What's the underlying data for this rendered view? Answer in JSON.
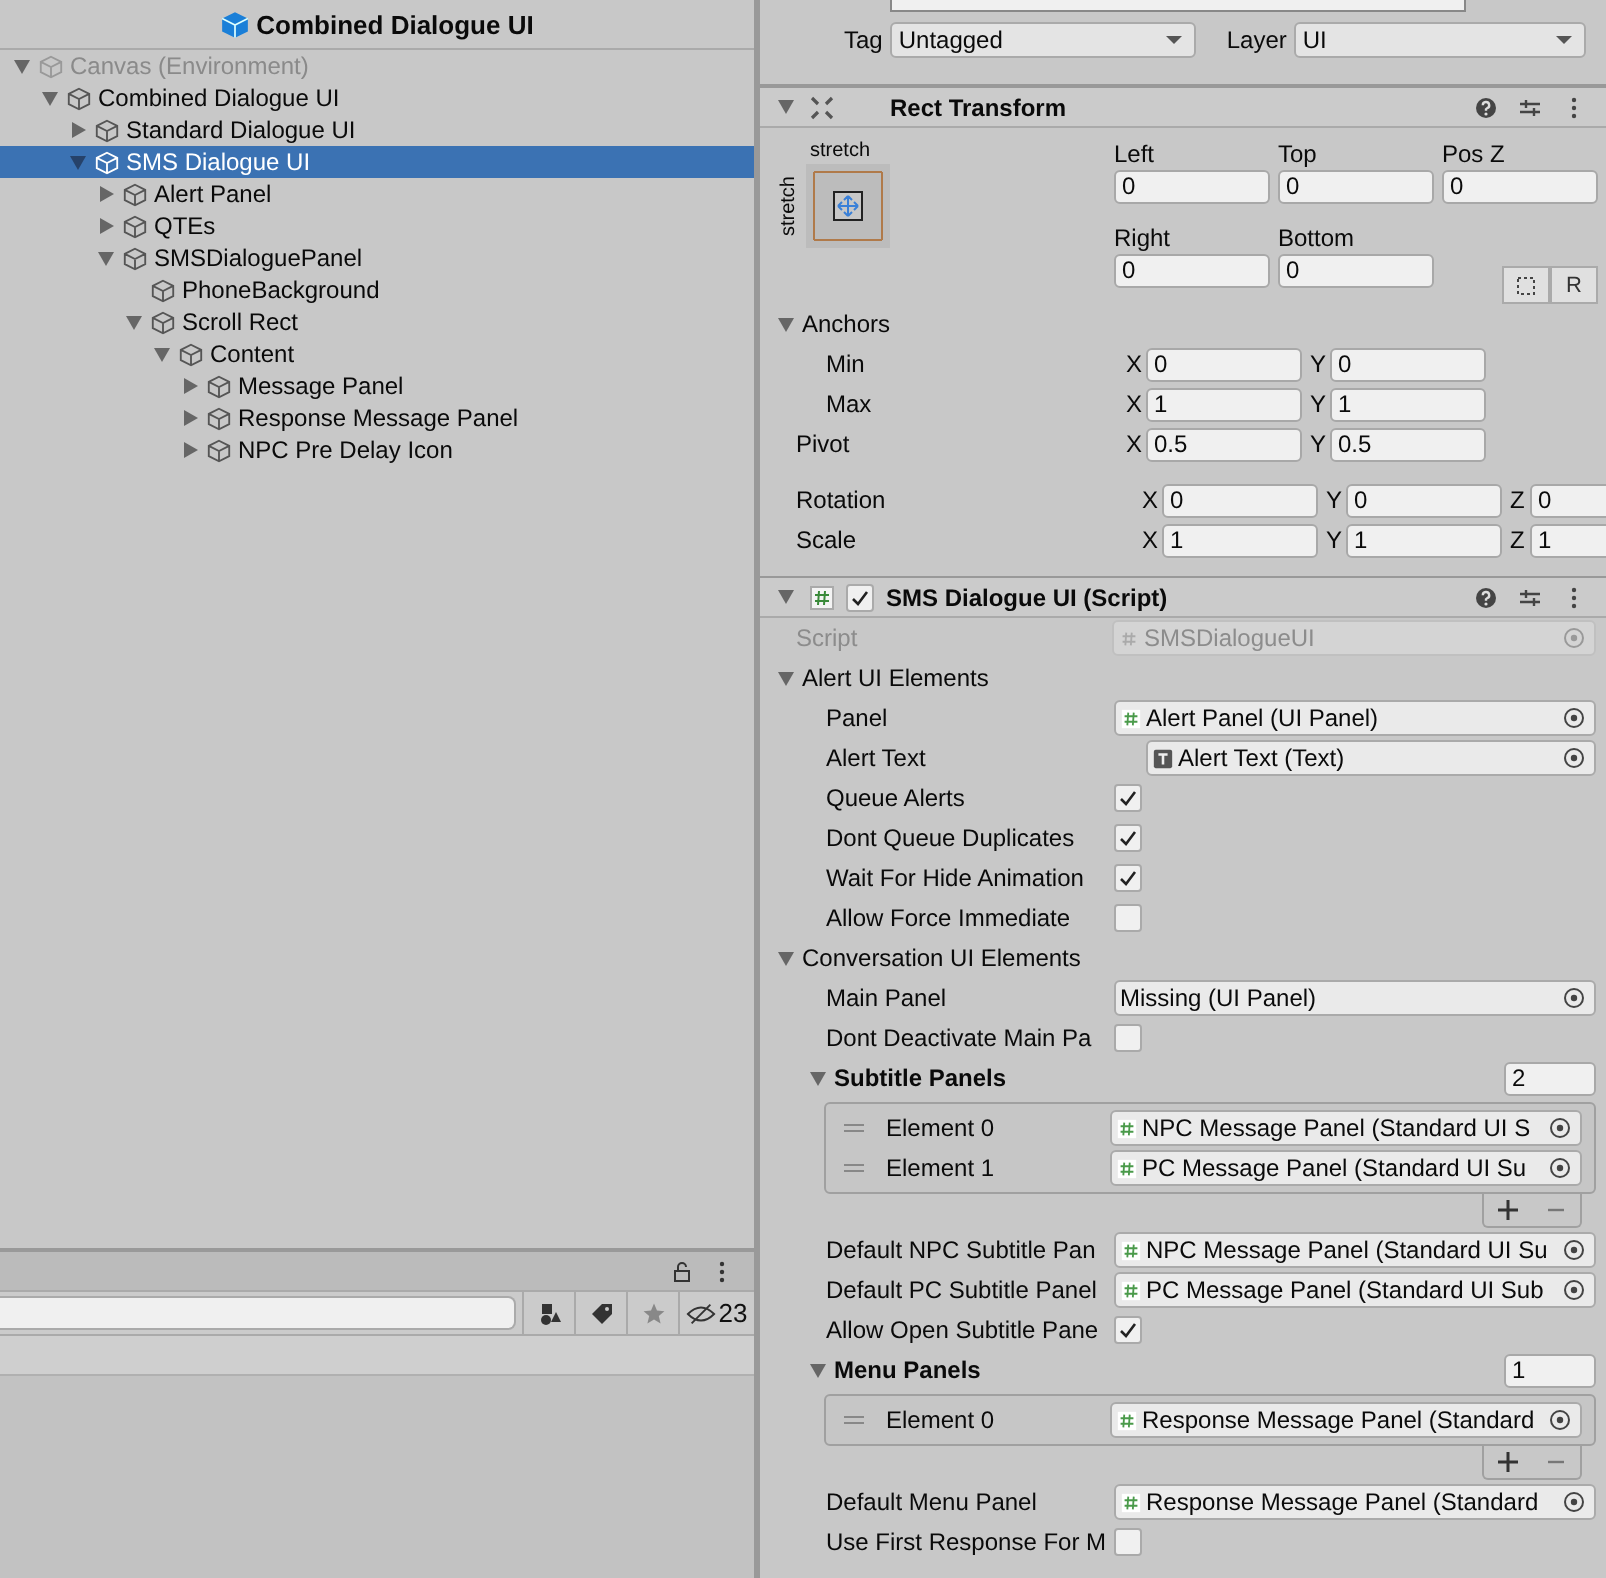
{
  "hierarchy": {
    "title": "Combined Dialogue UI",
    "items": [
      {
        "label": "Canvas (Environment)",
        "expandable": true,
        "expanded": true,
        "selected": false,
        "dimmed": true,
        "children": [
          {
            "label": "Combined Dialogue UI",
            "expandable": true,
            "expanded": true,
            "selected": false,
            "dimmed": false,
            "children": [
              {
                "label": "Standard Dialogue UI",
                "expandable": true,
                "expanded": false,
                "selected": false,
                "dimmed": false
              },
              {
                "label": "SMS Dialogue UI",
                "expandable": true,
                "expanded": true,
                "selected": true,
                "dimmed": false,
                "children": [
                  {
                    "label": "Alert Panel",
                    "expandable": true,
                    "expanded": false,
                    "selected": false,
                    "dimmed": false
                  },
                  {
                    "label": "QTEs",
                    "expandable": true,
                    "expanded": false,
                    "selected": false,
                    "dimmed": false
                  },
                  {
                    "label": "SMSDialoguePanel",
                    "expandable": true,
                    "expanded": true,
                    "selected": false,
                    "dimmed": false,
                    "children": [
                      {
                        "label": "PhoneBackground",
                        "expandable": false,
                        "selected": false,
                        "dimmed": false
                      },
                      {
                        "label": "Scroll Rect",
                        "expandable": true,
                        "expanded": true,
                        "selected": false,
                        "dimmed": false,
                        "children": [
                          {
                            "label": "Content",
                            "expandable": true,
                            "expanded": true,
                            "selected": false,
                            "dimmed": false,
                            "children": [
                              {
                                "label": "Message Panel",
                                "expandable": true,
                                "expanded": false,
                                "selected": false,
                                "dimmed": false
                              },
                              {
                                "label": "Response Message Panel",
                                "expandable": true,
                                "expanded": false,
                                "selected": false,
                                "dimmed": false
                              },
                              {
                                "label": "NPC Pre Delay Icon",
                                "expandable": true,
                                "expanded": false,
                                "selected": false,
                                "dimmed": false
                              }
                            ]
                          }
                        ]
                      }
                    ]
                  }
                ]
              }
            ]
          }
        ]
      }
    ]
  },
  "project_panel": {
    "hidden_count": "23"
  },
  "inspector": {
    "tag": {
      "label": "Tag",
      "value": "Untagged"
    },
    "layer": {
      "label": "Layer",
      "value": "UI"
    },
    "rect_transform": {
      "title": "Rect Transform",
      "expanded": true,
      "preset": {
        "horizontal": "stretch",
        "vertical": "stretch"
      },
      "offsets": [
        {
          "label": "Left",
          "value": "0"
        },
        {
          "label": "Top",
          "value": "0"
        },
        {
          "label": "Pos Z",
          "value": "0"
        },
        {
          "label": "Right",
          "value": "0"
        },
        {
          "label": "Bottom",
          "value": "0"
        }
      ],
      "raw_button": "R",
      "anchors": {
        "label": "Anchors",
        "expanded": true,
        "rows": [
          {
            "label": "Min",
            "axes": [
              {
                "axis": "X",
                "value": "0"
              },
              {
                "axis": "Y",
                "value": "0"
              }
            ]
          },
          {
            "label": "Max",
            "axes": [
              {
                "axis": "X",
                "value": "1"
              },
              {
                "axis": "Y",
                "value": "1"
              }
            ]
          }
        ]
      },
      "pivot": {
        "label": "Pivot",
        "axes": [
          {
            "axis": "X",
            "value": "0.5"
          },
          {
            "axis": "Y",
            "value": "0.5"
          }
        ]
      },
      "transform_rows": [
        {
          "label": "Rotation",
          "axes": [
            {
              "axis": "X",
              "value": "0"
            },
            {
              "axis": "Y",
              "value": "0"
            },
            {
              "axis": "Z",
              "value": "0"
            }
          ]
        },
        {
          "label": "Scale",
          "axes": [
            {
              "axis": "X",
              "value": "1"
            },
            {
              "axis": "Y",
              "value": "1"
            },
            {
              "axis": "Z",
              "value": "1"
            }
          ]
        }
      ]
    },
    "script_component": {
      "title": "SMS Dialogue UI (Script)",
      "expanded": true,
      "enabled": true,
      "script": {
        "label": "Script",
        "value": "SMSDialogueUI"
      },
      "groups": [
        {
          "label": "Alert UI Elements",
          "expanded": true,
          "fields": [
            {
              "kind": "object",
              "label": "Panel",
              "value": "Alert Panel (UI Panel)"
            },
            {
              "kind": "text_object",
              "label": "Alert Text",
              "value": "Alert Text (Text)"
            },
            {
              "kind": "checkbox",
              "label": "Queue Alerts",
              "checked": true
            },
            {
              "kind": "checkbox",
              "label": "Dont Queue Duplicates",
              "checked": true
            },
            {
              "kind": "checkbox",
              "label": "Wait For Hide Animation",
              "checked": true
            },
            {
              "kind": "checkbox",
              "label": "Allow Force Immediate",
              "checked": false
            }
          ]
        },
        {
          "label": "Conversation UI Elements",
          "expanded": true,
          "fields": [
            {
              "kind": "missing_object",
              "label": "Main Panel",
              "value": "Missing (UI Panel)"
            },
            {
              "kind": "checkbox",
              "label": "Dont Deactivate Main Pa",
              "checked": false
            },
            {
              "kind": "list",
              "label": "Subtitle Panels",
              "size": "2",
              "expanded": true,
              "elements": [
                {
                  "label": "Element 0",
                  "value": "NPC Message Panel (Standard UI S"
                },
                {
                  "label": "Element 1",
                  "value": "PC Message Panel (Standard UI Su"
                }
              ]
            },
            {
              "kind": "object",
              "label": "Default NPC Subtitle Pan",
              "value": "NPC Message Panel (Standard UI Su"
            },
            {
              "kind": "object",
              "label": "Default PC Subtitle Panel",
              "value": "PC Message Panel (Standard UI Sub"
            },
            {
              "kind": "checkbox",
              "label": "Allow Open Subtitle Pane",
              "checked": true
            },
            {
              "kind": "list",
              "label": "Menu Panels",
              "size": "1",
              "expanded": true,
              "elements": [
                {
                  "label": "Element 0",
                  "value": "Response Message Panel (Standard"
                }
              ]
            },
            {
              "kind": "object",
              "label": "Default Menu Panel",
              "value": "Response Message Panel (Standard"
            },
            {
              "kind": "checkbox",
              "label": "Use First Response For M",
              "checked": false
            }
          ]
        }
      ]
    }
  }
}
